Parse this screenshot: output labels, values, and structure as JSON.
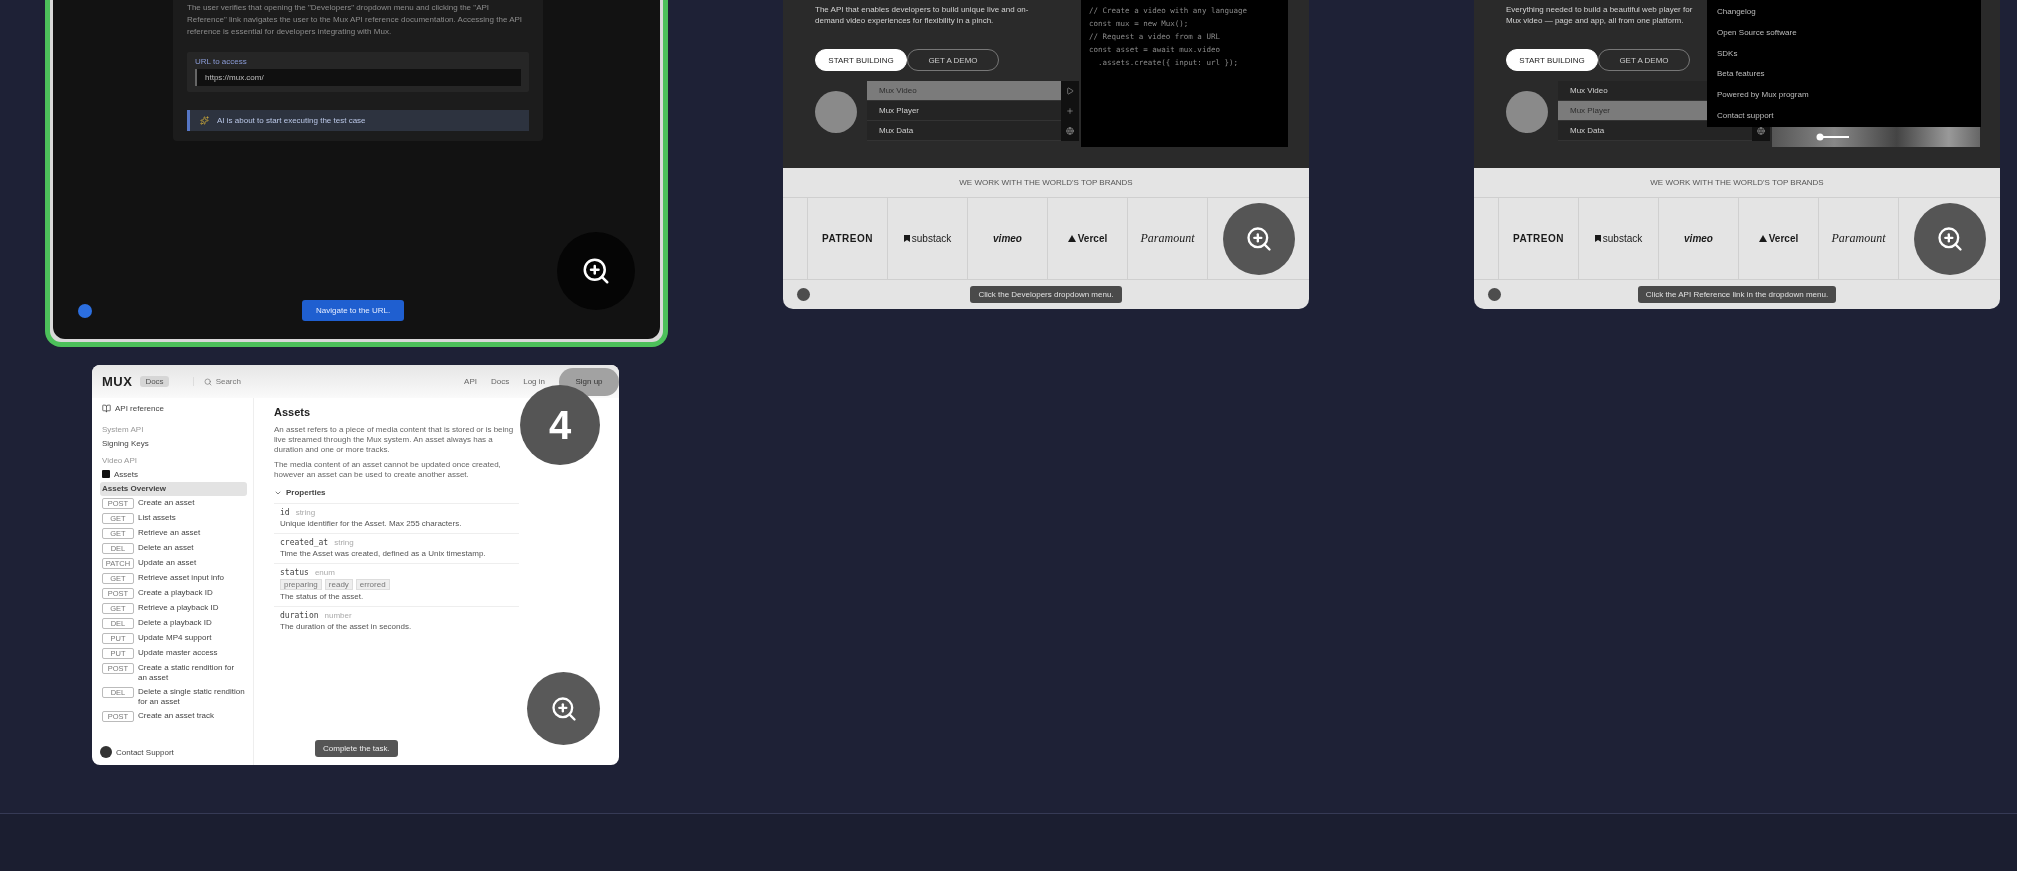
{
  "cards": [
    {
      "kind": "agent_step",
      "selected": true,
      "description": "The user verifies that opening the \"Developers\" dropdown menu and clicking the \"API Reference\" link navigates the user to the Mux API reference documentation. Accessing the API reference is essential for developers integrating with Mux.",
      "url_label": "URL to access",
      "url_value": "https://mux.com/",
      "notice": "AI is about to start executing the test case",
      "step_button": "Navigate to the URL."
    },
    {
      "kind": "site_step",
      "selected": false,
      "site": {
        "intro": "The API that enables developers to build unique live and on-demand video experiences for flexibility in a pinch.",
        "buttons": [
          {
            "label": "START BUILDING",
            "primary": true
          },
          {
            "label": "GET A DEMO",
            "primary": false
          }
        ],
        "products": [
          {
            "label": "Mux Video",
            "selected": true
          },
          {
            "label": "Mux Player",
            "selected": false
          },
          {
            "label": "Mux Data",
            "selected": false
          }
        ],
        "code_lines": [
          "// Create a video with any language",
          "const mux = new Mux();",
          "// Request a video from a URL",
          "const asset = await mux.video",
          "  .assets.create({ input: url });"
        ],
        "brands_heading": "WE WORK WITH THE WORLD'S TOP BRANDS",
        "brands": [
          {
            "name": "PATREON",
            "kind": "wordmark"
          },
          {
            "name": "substack",
            "kind": "bookmark"
          },
          {
            "name": "vimeo",
            "kind": "italic"
          },
          {
            "name": "Vercel",
            "kind": "triangle"
          },
          {
            "name": "Paramount",
            "kind": "script"
          }
        ]
      },
      "tooltip": "Click the Developers dropdown menu."
    },
    {
      "kind": "site_step",
      "selected": false,
      "site": {
        "intro": "Everything needed to build a beautiful web player for Mux video — page and app, all from one platform.",
        "buttons": [
          {
            "label": "START BUILDING",
            "primary": true
          },
          {
            "label": "GET A DEMO",
            "primary": false
          }
        ],
        "products": [
          {
            "label": "Mux Video",
            "selected": false
          },
          {
            "label": "Mux Player",
            "selected": true
          },
          {
            "label": "Mux Data",
            "selected": false
          }
        ],
        "dropdown": [
          "Changelog",
          "Open Source software",
          "SDKs",
          "Beta features",
          "Powered by Mux program",
          "Contact support"
        ],
        "brands_heading": "WE WORK WITH THE WORLD'S TOP BRANDS",
        "brands": [
          {
            "name": "PATREON",
            "kind": "wordmark"
          },
          {
            "name": "substack",
            "kind": "bookmark"
          },
          {
            "name": "vimeo",
            "kind": "italic"
          },
          {
            "name": "Vercel",
            "kind": "triangle"
          },
          {
            "name": "Paramount",
            "kind": "script"
          }
        ]
      },
      "tooltip": "Click the API Reference link in the dropdown menu."
    },
    {
      "kind": "docs_step",
      "selected": false,
      "step_number": "4",
      "docs": {
        "logo": "MUX",
        "badge": "Docs",
        "search": "Search",
        "links": [
          {
            "label": "API",
            "selected": false
          },
          {
            "label": "Docs",
            "selected": false
          },
          {
            "label": "Log in",
            "selected": false
          },
          {
            "label": "Sign up",
            "selected": true
          }
        ],
        "sidebar": [
          {
            "kind": "title",
            "label": "API reference",
            "selected": false
          },
          {
            "kind": "section",
            "label": "System API",
            "selected": false
          },
          {
            "kind": "link",
            "label": "Signing Keys",
            "selected": false
          },
          {
            "kind": "section",
            "label": "Video API",
            "selected": false
          },
          {
            "kind": "group",
            "label": "Assets",
            "selected": false
          },
          {
            "kind": "link",
            "label": "Assets Overview",
            "selected": true
          },
          {
            "kind": "endpoint",
            "method": "POST",
            "label": "Create an asset",
            "selected": false
          },
          {
            "kind": "endpoint",
            "method": "GET",
            "label": "List assets",
            "selected": false
          },
          {
            "kind": "endpoint",
            "method": "GET",
            "label": "Retrieve an asset",
            "selected": false
          },
          {
            "kind": "endpoint",
            "method": "DEL",
            "label": "Delete an asset",
            "selected": false
          },
          {
            "kind": "endpoint",
            "method": "PATCH",
            "label": "Update an asset",
            "selected": false
          },
          {
            "kind": "endpoint",
            "method": "GET",
            "label": "Retrieve asset input info",
            "selected": false
          },
          {
            "kind": "endpoint",
            "method": "POST",
            "label": "Create a playback ID",
            "selected": false
          },
          {
            "kind": "endpoint",
            "method": "GET",
            "label": "Retrieve a playback ID",
            "selected": false
          },
          {
            "kind": "endpoint",
            "method": "DEL",
            "label": "Delete a playback ID",
            "selected": false
          },
          {
            "kind": "endpoint",
            "method": "PUT",
            "label": "Update MP4 support",
            "selected": false
          },
          {
            "kind": "endpoint",
            "method": "PUT",
            "label": "Update master access",
            "selected": false
          },
          {
            "kind": "endpoint",
            "method": "POST",
            "label": "Create a static rendition for an asset",
            "selected": false
          },
          {
            "kind": "endpoint",
            "method": "DEL",
            "label": "Delete a single static rendition for an asset",
            "selected": false
          },
          {
            "kind": "endpoint",
            "method": "POST",
            "label": "Create an asset track",
            "selected": false
          }
        ],
        "contact": "Contact Support",
        "title": "Assets",
        "paragraphs": [
          "An asset refers to a piece of media content that is stored or is being live streamed through the Mux system. An asset always has a duration and one or more tracks.",
          "The media content of an asset cannot be updated once created, however an asset can be used to create another asset."
        ],
        "properties_heading": "Properties",
        "properties": [
          {
            "name": "id",
            "type": "string",
            "description": "Unique identifier for the Asset. Max 255 characters."
          },
          {
            "name": "created_at",
            "type": "string",
            "description": "Time the Asset was created, defined as a Unix timestamp."
          },
          {
            "name": "status",
            "type": "enum",
            "values": [
              "preparing",
              "ready",
              "errored"
            ],
            "description": "The status of the asset."
          },
          {
            "name": "duration",
            "type": "number",
            "description": "The duration of the asset in seconds."
          }
        ]
      },
      "tooltip": "Complete the task."
    }
  ]
}
